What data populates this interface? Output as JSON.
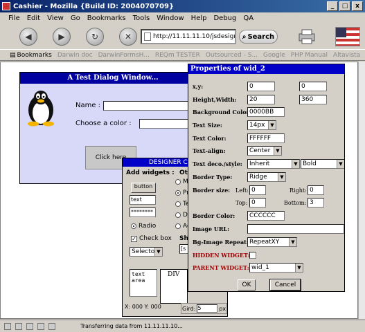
{
  "window": {
    "title": "Cashier - Mozilla {Build ID: 2004070709}",
    "buttons": [
      "_",
      "□",
      "x"
    ]
  },
  "menu": [
    "File",
    "Edit",
    "View",
    "Go",
    "Bookmarks",
    "Tools",
    "Window",
    "Help",
    "Debug",
    "QA"
  ],
  "toolbar": {
    "url": "http://11.11.11.10/jsdesign",
    "search_label": "Search"
  },
  "bookmarks": {
    "label": "Bookmarks",
    "items": [
      "Darwin doc",
      "DarwinFormsH...",
      "REQm TESTER",
      "Outsourced - S...",
      "Google",
      "PHP Manual",
      "Altavista"
    ]
  },
  "status": {
    "text": "Transferring data from 11.11.11.10..."
  },
  "test_dialog": {
    "title": "A Test Dialog Window...",
    "name_label": "Name :",
    "color_label": "Choose a color :",
    "button_label": "Click here"
  },
  "designer": {
    "title": "DESIGNER Co",
    "add_widgets": "Add widgets :",
    "other_label": "Oth",
    "button_label": "button",
    "text_value": "text",
    "password_value": "********",
    "radio_label": "Radio",
    "checkbox_label": "Check box",
    "selector_label": "Selector",
    "other_options": [
      "M",
      "Pr",
      "Te",
      "De",
      "Ac"
    ],
    "show_label": "Sho",
    "show_value": "[s",
    "textarea_text": "text area",
    "div_label": "DIV",
    "coords": "X: 000 Y: 000",
    "grid_label": "Gird:",
    "grid_value": "5",
    "grid_unit": "px"
  },
  "properties": {
    "title": "Properties of wid_2",
    "xy_label": "x,y:",
    "x": "0",
    "y": "0",
    "hw_label": "Height,Width:",
    "height": "20",
    "width": "360",
    "bg_label": "Background Color:",
    "bg_value": "0000BB",
    "size_label": "Text Size:",
    "size_value": "14px",
    "color_label": "Text Color:",
    "color_value": "FFFFFF",
    "align_label": "Text-align:",
    "align_value": "Center",
    "deco_label": "Text deco./style:",
    "deco_value": "Inherit",
    "style_value": "Bold",
    "border_type_label": "Border Type:",
    "border_type_value": "Ridge",
    "border_size_label": "Border size:",
    "left_label": "Left:",
    "left_value": "0",
    "right_label": "Right:",
    "right_value": "0",
    "top_label": "Top:",
    "top_value": "0",
    "bottom_label": "Bottom:",
    "bottom_value": "3",
    "border_color_label": "Border Color:",
    "border_color_value": "CCCCCC",
    "image_url_label": "Image URL:",
    "image_url_value": "",
    "bg_repeat_label": "Bg-Image Repeat:",
    "bg_repeat_value": "RepeatXY",
    "hidden_label": "HIDDEN WIDGET:",
    "parent_label": "PARENT WIDGET:",
    "parent_value": "wid_1",
    "ok_label": "OK",
    "cancel_label": "Cancel"
  },
  "colors": {
    "title_bar": "#0a246a",
    "dialog_title": "#0000a0",
    "props_title": "#0000c8",
    "dialog_bg": "#d8d8f8",
    "label_red": "#a00000"
  }
}
